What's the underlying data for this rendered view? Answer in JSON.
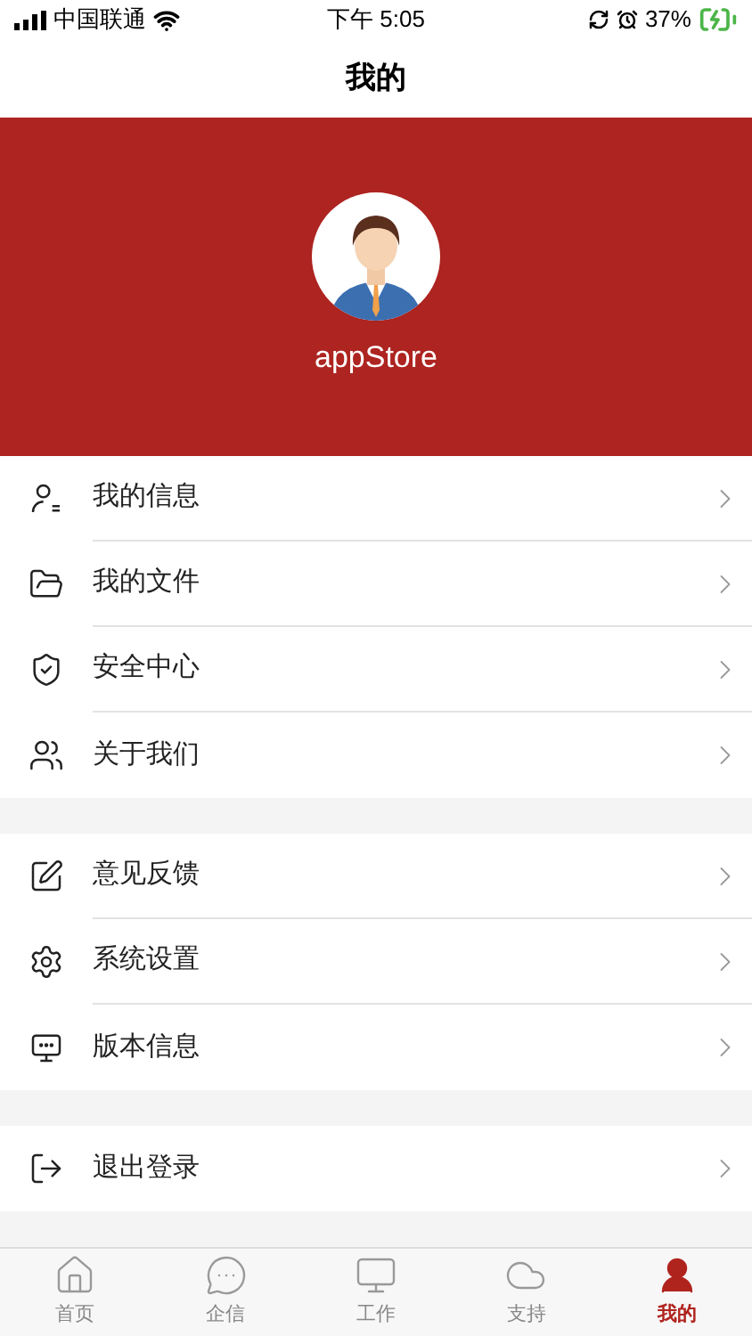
{
  "status_bar": {
    "carrier": "中国联通",
    "time": "下午 5:05",
    "battery": "37%"
  },
  "nav": {
    "title": "我的"
  },
  "profile": {
    "name": "appStore"
  },
  "menu_groups": [
    {
      "items": [
        {
          "kind": "user",
          "label": "我的信息"
        },
        {
          "kind": "folder",
          "label": "我的文件"
        },
        {
          "kind": "shield",
          "label": "安全中心"
        },
        {
          "kind": "users",
          "label": "关于我们"
        }
      ]
    },
    {
      "items": [
        {
          "kind": "edit",
          "label": "意见反馈"
        },
        {
          "kind": "settings",
          "label": "系统设置"
        },
        {
          "kind": "monitor",
          "label": "版本信息"
        }
      ]
    },
    {
      "items": [
        {
          "kind": "logout",
          "label": "退出登录"
        }
      ]
    }
  ],
  "tab_bar": [
    {
      "kind": "home",
      "label": "首页",
      "selected": false
    },
    {
      "kind": "chat",
      "label": "企信",
      "selected": false
    },
    {
      "kind": "work",
      "label": "工作",
      "selected": false
    },
    {
      "kind": "cloud",
      "label": "支持",
      "selected": false
    },
    {
      "kind": "me",
      "label": "我的",
      "selected": true
    }
  ]
}
